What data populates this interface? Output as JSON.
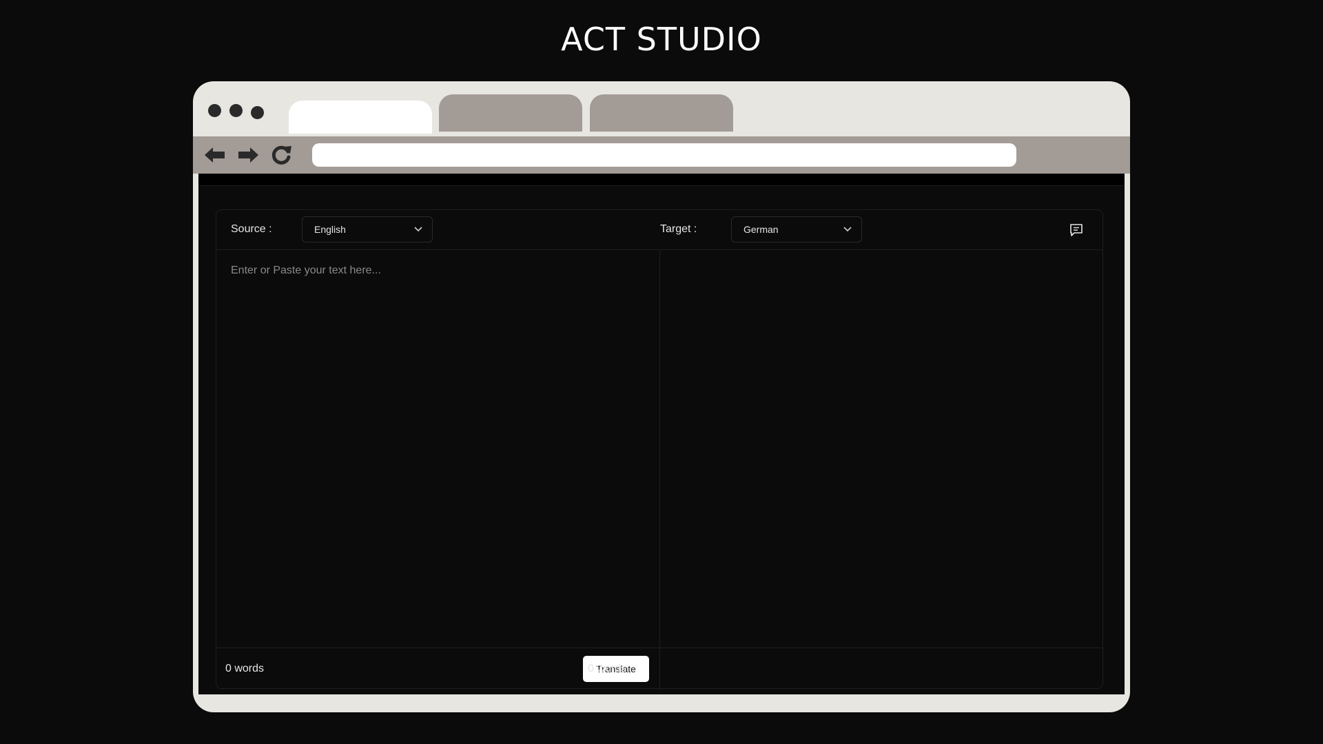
{
  "page": {
    "title": "ACT STUDIO"
  },
  "browser": {
    "url": ""
  },
  "translator": {
    "source_label": "Source :",
    "source_language": "English",
    "target_label": "Target :",
    "target_language": "German",
    "input_placeholder": "Enter or Paste your text here...",
    "source_word_count": "0 words",
    "target_word_count": "0 words",
    "translate_label": "Translate"
  },
  "colors": {
    "background": "#0b0b0b",
    "browser_frame": "#e7e6e1",
    "tab_inactive": "#a39b95",
    "toolbar": "#a39b95"
  },
  "icons": {
    "back": "arrow-left-icon",
    "forward": "arrow-right-icon",
    "reload": "reload-icon",
    "dropdown": "chevron-down-icon",
    "chat": "chat-icon"
  }
}
